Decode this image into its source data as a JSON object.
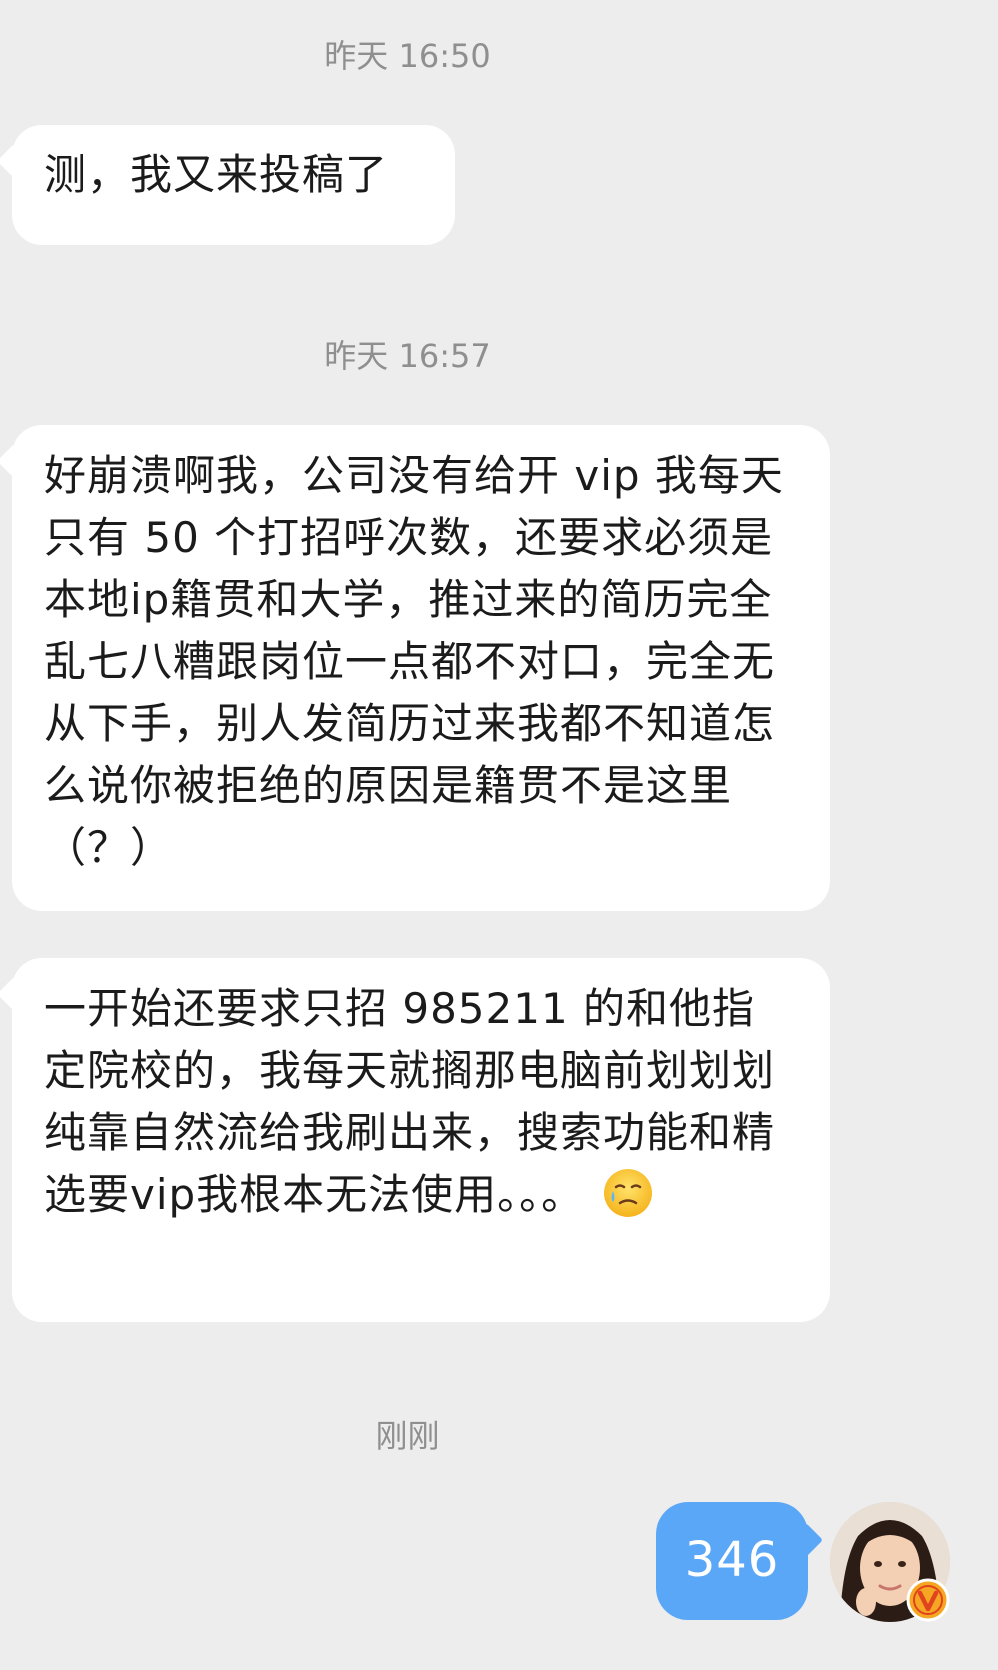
{
  "messages": [
    {
      "type": "timestamp",
      "text": "昨天 16:50"
    },
    {
      "type": "incoming",
      "text": "测，我又来投稿了"
    },
    {
      "type": "timestamp",
      "text": "昨天 16:57"
    },
    {
      "type": "incoming",
      "text": "好崩溃啊我，公司没有给开 vip 我每天只有 50 个打招呼次数，还要求必须是本地ip籍贯和大学，推过来的简历完全乱七八糟跟岗位一点都不对口，完全无从下手，别人发简历过来我都不知道怎么说你被拒绝的原因是籍贯不是这里（？）"
    },
    {
      "type": "incoming",
      "text": "一开始还要求只招 985211 的和他指定院校的，我每天就搁那电脑前划划划纯靠自然流给我刷出来，搜索功能和精选要vip我根本无法使用。。。",
      "emoji": "crying-face-with-tear-emoji"
    },
    {
      "type": "timestamp",
      "text": "刚刚"
    },
    {
      "type": "outgoing",
      "text": "346"
    }
  ],
  "avatar": {
    "icon": "user-avatar-photo",
    "badge_icon": "verified-v-badge-icon",
    "badge_color": "#f5a623"
  },
  "colors": {
    "background": "#ededed",
    "incoming_bubble": "#ffffff",
    "outgoing_bubble": "#5aa7f7",
    "timestamp": "#8f8f8f"
  }
}
